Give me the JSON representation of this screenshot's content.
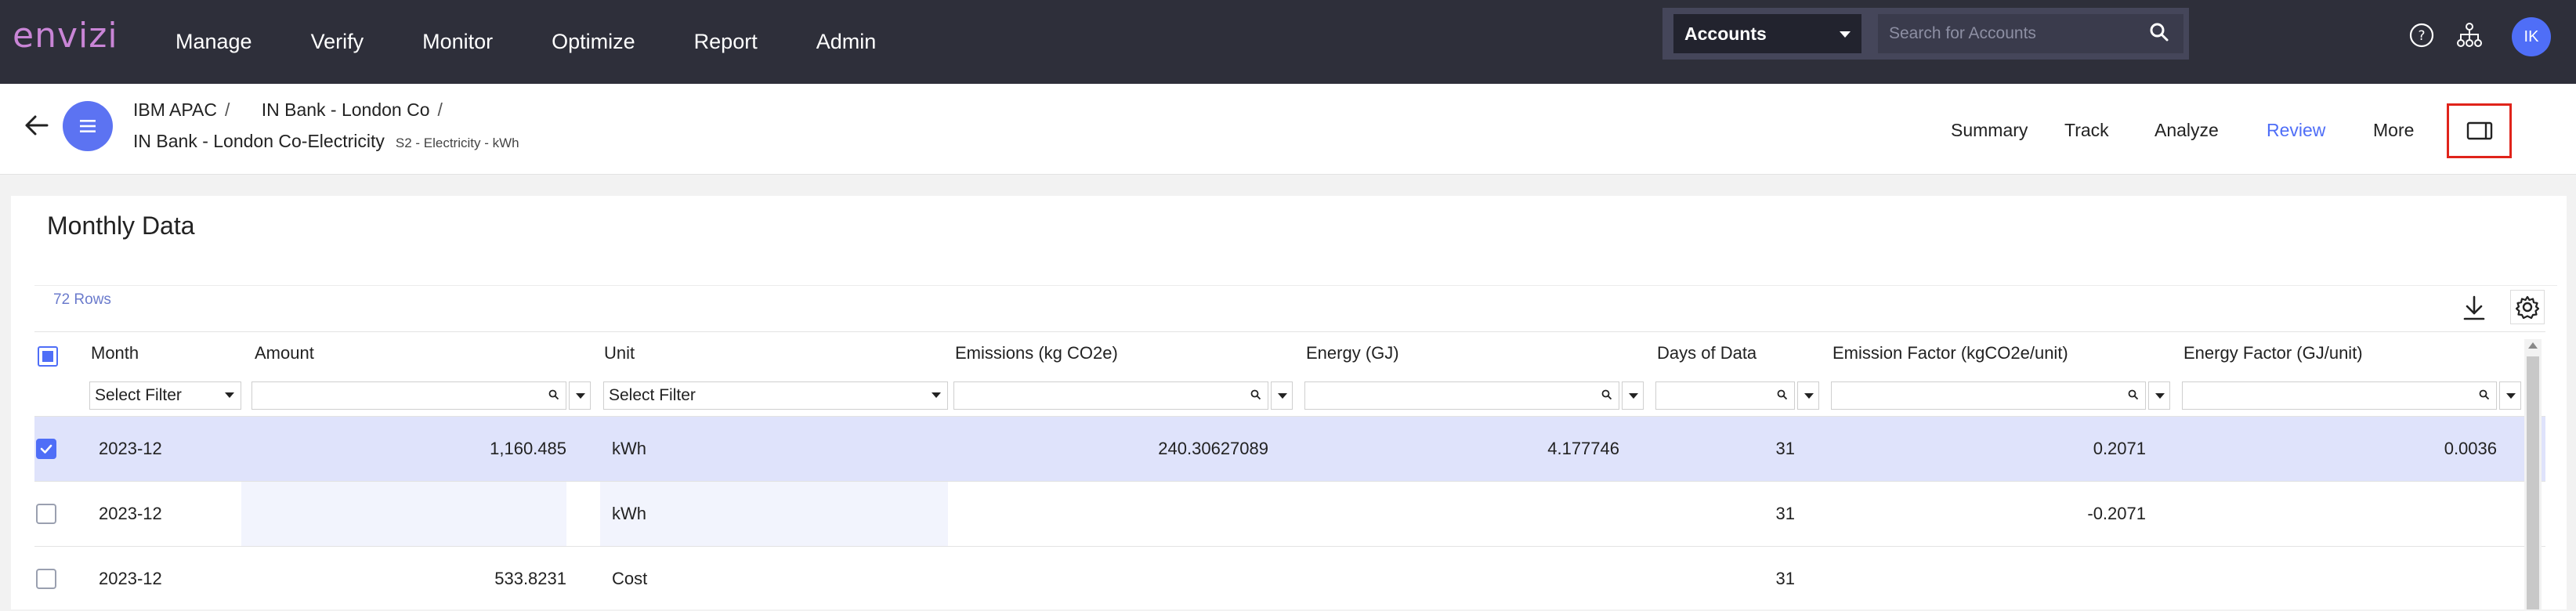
{
  "app": {
    "logo": "envizi",
    "menu": [
      "Manage",
      "Verify",
      "Monitor",
      "Optimize",
      "Report",
      "Admin"
    ],
    "account_select": "Accounts",
    "search_placeholder": "Search for Accounts",
    "avatar_initials": "IK"
  },
  "breadcrumb": {
    "level1": "IBM APAC",
    "level2": "IN Bank - London Co",
    "separator": "/",
    "current": "IN Bank - London Co-Electricity",
    "subtitle": "S2 - Electricity - kWh"
  },
  "tabs": [
    "Summary",
    "Track",
    "Analyze",
    "Review",
    "More"
  ],
  "active_tab": "Review",
  "card": {
    "title": "Monthly Data",
    "rows_count": "72 Rows"
  },
  "table": {
    "columns": [
      "Month",
      "Amount",
      "Unit",
      "Emissions (kg CO2e)",
      "Energy (GJ)",
      "Days of Data",
      "Emission Factor (kgCO2e/unit)",
      "Energy Factor (GJ/unit)"
    ],
    "filters": {
      "month": "Select Filter",
      "unit": "Select Filter"
    },
    "rows": [
      {
        "month": "2023-12",
        "amount": "1,160.485",
        "unit": "kWh",
        "emissions": "240.30627089",
        "energy": "4.177746",
        "days": "31",
        "ef": "0.2071",
        "enf": "0.0036",
        "selected": true
      },
      {
        "month": "2023-12",
        "amount": "",
        "unit": "kWh",
        "emissions": "",
        "energy": "",
        "days": "31",
        "ef": "-0.2071",
        "enf": "",
        "selected": false
      },
      {
        "month": "2023-12",
        "amount": "533.8231",
        "unit": "Cost",
        "emissions": "",
        "energy": "",
        "days": "31",
        "ef": "",
        "enf": "",
        "selected": false
      }
    ]
  },
  "colors": {
    "nav_bg": "#2e2f3a",
    "accent": "#4f6ef7",
    "logo": "#c985d6",
    "highlight_border": "#e0241b",
    "selected_row": "#dfe3fb"
  }
}
